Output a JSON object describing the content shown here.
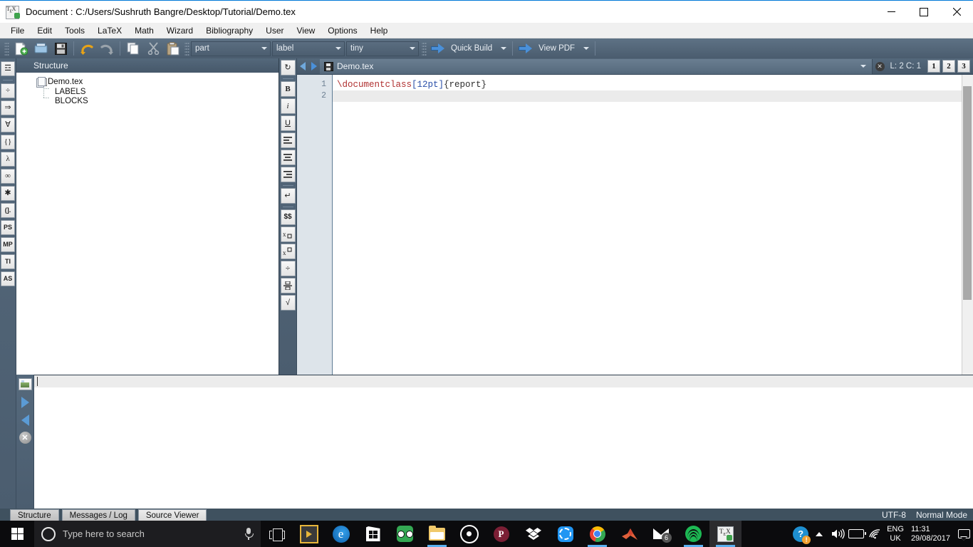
{
  "window": {
    "title": "Document : C:/Users/Sushruth Bangre/Desktop/Tutorial/Demo.tex",
    "app_icon": "texstudio-icon",
    "minimize_label": "—",
    "maximize_label": "□",
    "close_label": "✕"
  },
  "menubar": {
    "items": [
      {
        "label": "File",
        "name": "menu-file"
      },
      {
        "label": "Edit",
        "name": "menu-edit"
      },
      {
        "label": "Tools",
        "name": "menu-tools"
      },
      {
        "label": "LaTeX",
        "name": "menu-latex"
      },
      {
        "label": "Math",
        "name": "menu-math"
      },
      {
        "label": "Wizard",
        "name": "menu-wizard"
      },
      {
        "label": "Bibliography",
        "name": "menu-bibliography"
      },
      {
        "label": "User",
        "name": "menu-user"
      },
      {
        "label": "View",
        "name": "menu-view"
      },
      {
        "label": "Options",
        "name": "menu-options"
      },
      {
        "label": "Help",
        "name": "menu-help"
      }
    ]
  },
  "toolbar": {
    "icons": [
      {
        "name": "new-file-icon",
        "glyph": "new"
      },
      {
        "name": "open-file-icon",
        "glyph": "open"
      },
      {
        "name": "save-file-icon",
        "glyph": "save"
      },
      {
        "name": "undo-icon",
        "glyph": "undo"
      },
      {
        "name": "redo-icon",
        "glyph": "redo"
      },
      {
        "name": "copy-icon",
        "glyph": "copy"
      },
      {
        "name": "cut-icon",
        "glyph": "cut"
      },
      {
        "name": "paste-icon",
        "glyph": "paste"
      }
    ],
    "structure_level": "part",
    "reference_type": "label",
    "font_size": "tiny",
    "quick_build_label": "Quick Build",
    "view_pdf_label": "View PDF"
  },
  "math_sidebar": {
    "items": [
      {
        "label": "☲",
        "name": "sidebar-environments"
      },
      {
        "label": "÷",
        "name": "sidebar-operators"
      },
      {
        "label": "⇒",
        "name": "sidebar-relations"
      },
      {
        "label": "∀",
        "name": "sidebar-quantifiers"
      },
      {
        "label": "{}",
        "name": "sidebar-brackets"
      },
      {
        "label": "λ",
        "name": "sidebar-greek"
      },
      {
        "label": "∞",
        "name": "sidebar-misc-symbols"
      },
      {
        "label": "✱",
        "name": "sidebar-stars"
      },
      {
        "label": "(].",
        "name": "sidebar-delimiters"
      },
      {
        "label": "PS",
        "name": "sidebar-psi-symbols"
      },
      {
        "label": "MP",
        "name": "sidebar-metapost"
      },
      {
        "label": "TI",
        "name": "sidebar-tikz"
      },
      {
        "label": "AS",
        "name": "sidebar-asymptote"
      }
    ]
  },
  "format_toolbar": {
    "refresh": {
      "label": "↻",
      "name": "refresh-structure-icon"
    },
    "items": [
      {
        "label": "B",
        "name": "bold-button"
      },
      {
        "label": "i",
        "name": "italic-button"
      },
      {
        "label": "U",
        "name": "underline-button"
      },
      {
        "label": "≡",
        "name": "align-left-button"
      },
      {
        "label": "≡",
        "name": "align-center-button"
      },
      {
        "label": "≡",
        "name": "align-right-button"
      },
      {
        "label": "↵",
        "name": "newline-button"
      },
      {
        "label": "$$",
        "name": "math-mode-button"
      },
      {
        "label": "x□",
        "name": "subscript-button"
      },
      {
        "label": "x□",
        "name": "superscript-button"
      },
      {
        "label": "÷",
        "name": "fraction-button"
      },
      {
        "label": "□",
        "name": "dfrac-button"
      },
      {
        "label": "√",
        "name": "sqrt-button"
      }
    ]
  },
  "structure_panel": {
    "header": "Structure",
    "tree": [
      {
        "label": "Demo.tex",
        "level": 0,
        "name": "structure-node-document"
      },
      {
        "label": "LABELS",
        "level": 1,
        "name": "structure-node-labels"
      },
      {
        "label": "BLOCKS",
        "level": 1,
        "name": "structure-node-blocks"
      }
    ],
    "expander": "−"
  },
  "editor": {
    "tab_label": "Demo.tex",
    "close_label": "✕",
    "cursor_position": "L: 2 C: 1",
    "view_buttons": [
      "1",
      "2",
      "3"
    ],
    "lines": [
      {
        "number": "1",
        "current": false,
        "tokens": [
          {
            "text": "\\documentclass",
            "cls": "k-cmd"
          },
          {
            "text": "[12pt]",
            "cls": "k-opt"
          },
          {
            "text": "{report}",
            "cls": "k-brace"
          }
        ]
      },
      {
        "number": "2",
        "current": true,
        "tokens": []
      }
    ]
  },
  "output_panel": {
    "icons": [
      {
        "name": "preview-image-icon"
      },
      {
        "name": "next-error-icon"
      },
      {
        "name": "previous-error-icon"
      },
      {
        "name": "stop-process-icon"
      }
    ],
    "content": ""
  },
  "bottom_tabs": [
    {
      "label": "Structure",
      "name": "tab-structure",
      "active": false
    },
    {
      "label": "Messages / Log",
      "name": "tab-messages-log",
      "active": false
    },
    {
      "label": "Source Viewer",
      "name": "tab-source-viewer",
      "active": true
    }
  ],
  "status_bar": {
    "encoding": "UTF-8",
    "mode": "Normal Mode"
  },
  "taskbar": {
    "start_icon": "windows-start-icon",
    "search_placeholder": "Type here to search",
    "mic_icon": "microphone-icon",
    "apps": [
      {
        "name": "task-view-icon",
        "kind": "taskview"
      },
      {
        "name": "labview-icon",
        "kind": "labview"
      },
      {
        "name": "microsoft-edge-icon",
        "kind": "edge",
        "letter": "e"
      },
      {
        "name": "microsoft-store-icon",
        "kind": "store"
      },
      {
        "name": "tripadvisor-icon",
        "kind": "trip"
      },
      {
        "name": "file-explorer-icon",
        "kind": "folder"
      },
      {
        "name": "media-player-icon",
        "kind": "ring"
      },
      {
        "name": "pioneer-app-icon",
        "kind": "p",
        "letter": "P"
      },
      {
        "name": "dropbox-icon",
        "kind": "dropbox"
      },
      {
        "name": "shareit-icon",
        "kind": "share"
      },
      {
        "name": "google-chrome-icon",
        "kind": "chrome"
      },
      {
        "name": "matlab-icon",
        "kind": "matlab"
      },
      {
        "name": "mail-icon",
        "kind": "mail",
        "badge": "6"
      },
      {
        "name": "spotify-icon",
        "kind": "spotify"
      },
      {
        "name": "texstudio-taskbar-icon",
        "kind": "texstudio",
        "active": true
      }
    ],
    "tray": {
      "help_icon": "help-warning-icon",
      "chevron_icon": "show-hidden-icons-chevron",
      "volume_icon": "volume-icon",
      "battery_icon": "battery-icon",
      "wifi_icon": "wifi-icon",
      "language_line1": "ENG",
      "language_line2": "UK",
      "time": "11:31",
      "date": "29/08/2017",
      "notifications_icon": "action-center-icon"
    }
  },
  "colors": {
    "accent": "#0078d7",
    "toolbar": "#4f6376",
    "command": "#b03030",
    "option": "#2a4fa8"
  }
}
